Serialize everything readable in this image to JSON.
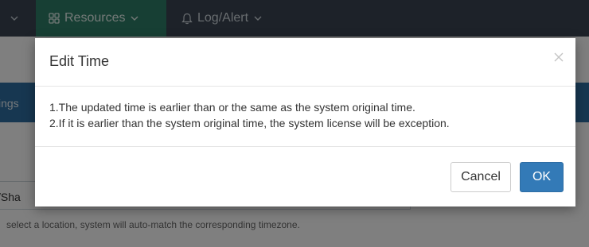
{
  "nav": {
    "resources_label": "Resources",
    "log_alert_label": "Log/Alert"
  },
  "background": {
    "settings_label": "ings",
    "zone_value": "/Sha",
    "hint": "select a location, system will auto-match the corresponding timezone."
  },
  "modal": {
    "title": "Edit Time",
    "line1": "1.The updated time is earlier than or the same as the system original time.",
    "line2": "2.If it is earlier than the system original time, the system license will be exception.",
    "cancel_label": "Cancel",
    "ok_label": "OK"
  },
  "colors": {
    "nav_bg": "#3a4552",
    "nav_active": "#2f7f68",
    "settings_bar": "#2f6fa2",
    "primary_button": "#337ab7"
  },
  "icons": {
    "resources": "grid-icon",
    "log_alert": "bell-icon",
    "close": "close-icon"
  }
}
